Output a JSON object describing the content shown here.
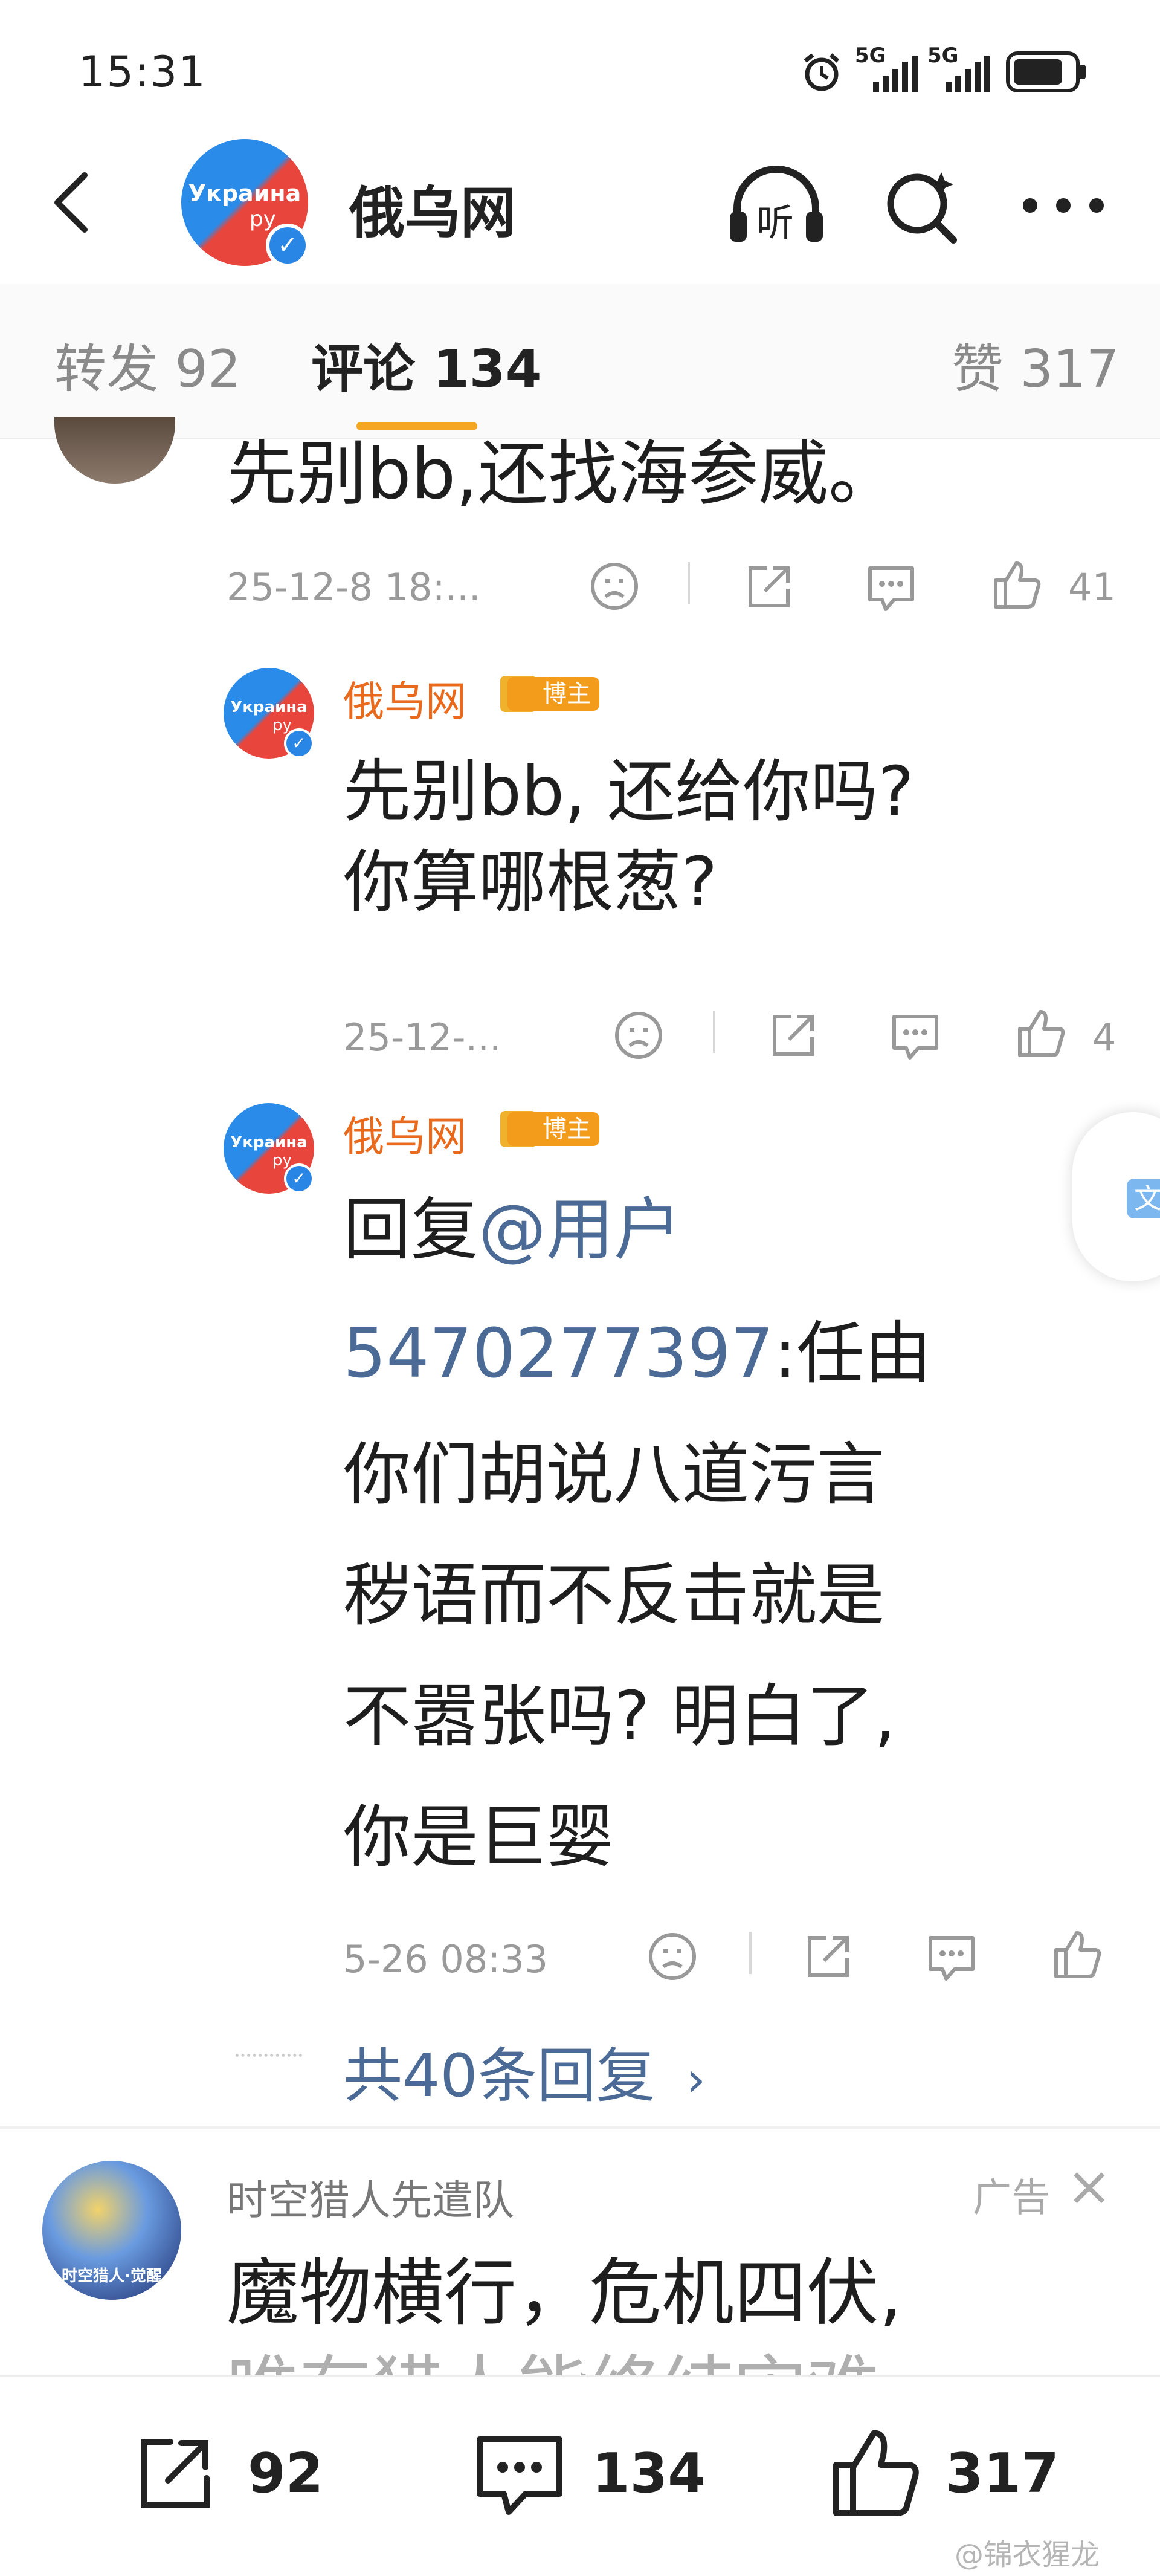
{
  "status_bar": {
    "time": "15:31",
    "network_labels": [
      "5G",
      "5G"
    ]
  },
  "header": {
    "title": "俄乌网",
    "logo_text": "Украина",
    "logo_sub": "ру",
    "listen_label": "听"
  },
  "tabs": {
    "repost": "转发 92",
    "comments": "评论 134",
    "likes": "赞 317"
  },
  "comments": [
    {
      "text": "先别bb,还找海参威。",
      "time": "25-12-8 18:...",
      "likes": "41"
    }
  ],
  "replies": [
    {
      "author": "俄乌网",
      "badge": "博主",
      "lines": [
        "先别bb, 还给你吗?",
        "你算哪根葱?"
      ],
      "time": "25-12-...",
      "likes": "4"
    },
    {
      "author": "俄乌网",
      "badge": "博主",
      "reply_prefix": "回复",
      "mention": "@用户",
      "mention_id": "5470277397",
      "lines_after": [
        ":任由",
        "你们胡说八道污言",
        "秽语而不反击就是",
        "不嚣张吗? 明白了,",
        "你是巨婴"
      ],
      "time": "5-26 08:33",
      "likes": ""
    }
  ],
  "more_replies": "共40条回复",
  "more_replies_arrow": "›",
  "floating_button": "文",
  "ad": {
    "author": "时空猎人先遣队",
    "avatar_text": "时空猎人·觉醒",
    "label": "广告",
    "close": "×",
    "text": "魔物横行，危机四伏,",
    "text_partial": "唯有猎人能终结灾难"
  },
  "bottom_bar": {
    "repost_count": "92",
    "comment_count": "134",
    "like_count": "317"
  },
  "watermark": "@锦衣猩龙",
  "colors": {
    "accent_orange": "#e96a1c",
    "tab_underline": "#f5a623",
    "link_blue": "#4b6a96"
  }
}
